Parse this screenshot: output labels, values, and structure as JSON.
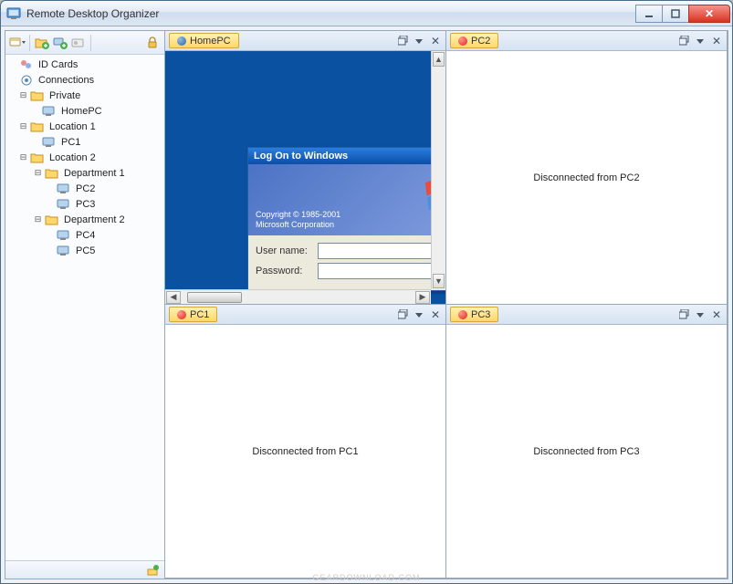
{
  "window": {
    "title": "Remote Desktop Organizer"
  },
  "sidebar": {
    "roots": {
      "idcards": "ID Cards",
      "connections": "Connections"
    },
    "tree": {
      "private": {
        "label": "Private",
        "children": {
          "homepc": "HomePC"
        }
      },
      "location1": {
        "label": "Location 1",
        "children": {
          "pc1": "PC1"
        }
      },
      "location2": {
        "label": "Location 2",
        "dept1": {
          "label": "Department 1",
          "pc2": "PC2",
          "pc3": "PC3"
        },
        "dept2": {
          "label": "Department 2",
          "pc4": "PC4",
          "pc5": "PC5"
        }
      }
    }
  },
  "panes": {
    "p0": {
      "title": "HomePC",
      "status": "blue"
    },
    "p1": {
      "title": "PC2",
      "status": "red",
      "message": "Disconnected from PC2"
    },
    "p2": {
      "title": "PC1",
      "status": "red",
      "message": "Disconnected from PC1"
    },
    "p3": {
      "title": "PC3",
      "status": "red",
      "message": "Disconnected from PC3"
    }
  },
  "logon": {
    "title": "Log On to Windows",
    "copyright1": "Copyright © 1985-2001",
    "copyright2": "Microsoft Corporation",
    "username_label": "User name:",
    "password_label": "Password:"
  },
  "watermark": "GEARDOWNLOAD.COM"
}
